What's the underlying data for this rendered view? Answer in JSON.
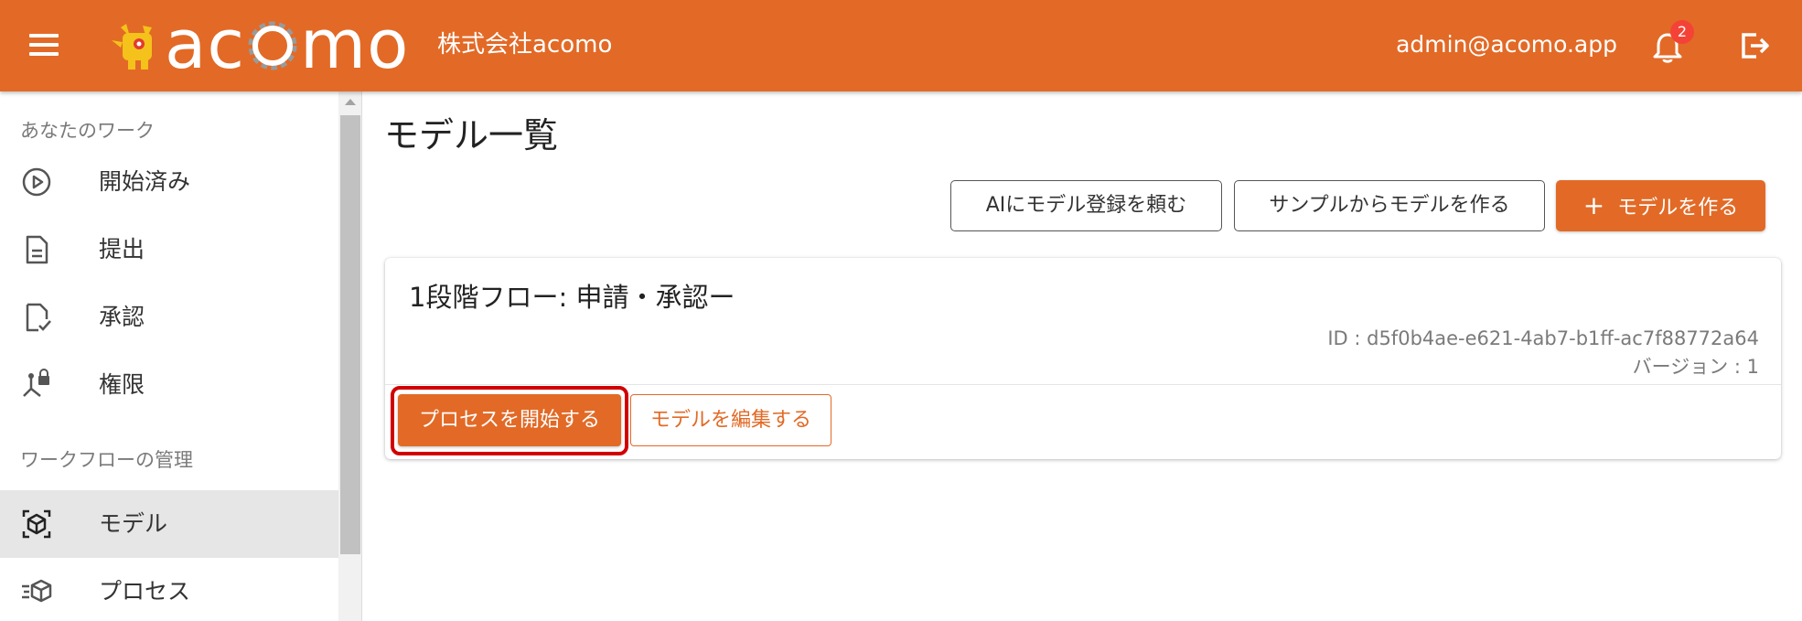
{
  "header": {
    "logo_text_a": "ac",
    "logo_text_b": "mo",
    "company": "株式会社acomo",
    "user_email": "admin@acomo.app",
    "notification_count": "2",
    "brand_color": "#e26a26"
  },
  "sidebar": {
    "section_work": "あなたのワーク",
    "section_workflow": "ワークフローの管理",
    "items": [
      {
        "label": "開始済み",
        "icon": "play-circle-icon"
      },
      {
        "label": "提出",
        "icon": "document-icon"
      },
      {
        "label": "承認",
        "icon": "document-check-icon"
      },
      {
        "label": "権限",
        "icon": "permission-lock-icon"
      },
      {
        "label": "モデル",
        "icon": "model-cube-icon",
        "active": true
      },
      {
        "label": "プロセス",
        "icon": "process-cube-icon"
      }
    ]
  },
  "main": {
    "title": "モデル一覧",
    "actions": {
      "ai_register": "AIにモデル登録を頼む",
      "from_sample": "サンプルからモデルを作る",
      "create_plus": "+",
      "create": "モデルを作る"
    },
    "card": {
      "title": "1段階フロー: 申請・承認ー",
      "id": "ID : d5f0b4ae-e621-4ab7-b1ff-ac7f88772a64",
      "version": "バージョン : 1",
      "start_button": "プロセスを開始する",
      "edit_button": "モデルを編集する"
    }
  }
}
